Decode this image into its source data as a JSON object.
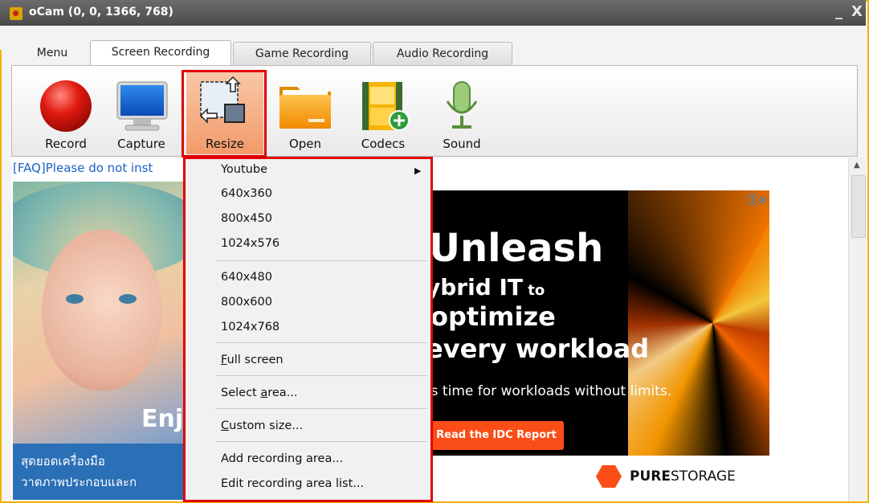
{
  "window": {
    "title": "oCam (0, 0, 1366, 768)",
    "minimize": "_",
    "close": "X"
  },
  "tabs": [
    {
      "label": "Menu"
    },
    {
      "label": "Screen Recording"
    },
    {
      "label": "Game Recording"
    },
    {
      "label": "Audio Recording"
    }
  ],
  "toolbar": {
    "record": "Record",
    "capture": "Capture",
    "resize": "Resize",
    "open": "Open",
    "codecs": "Codecs",
    "sound": "Sound"
  },
  "faq_text": "[FAQ]Please do not inst",
  "resize_menu": {
    "youtube": "Youtube",
    "r1": "640x360",
    "r2": "800x450",
    "r3": "1024x576",
    "r4": "640x480",
    "r5": "800x600",
    "r6": "1024x768",
    "full_prefix": "F",
    "full_rest": "ull screen",
    "select_prefix": "Select ",
    "select_accel": "a",
    "select_rest": "rea...",
    "custom_prefix": "C",
    "custom_rest": "ustom size...",
    "add_area": "Add recording area...",
    "edit_area": "Edit recording area list..."
  },
  "ad_left": {
    "enjoy": "Enj",
    "thai_line1": "สุดยอดเครื่องมือ",
    "thai_line2": "วาดภาพประกอบและก"
  },
  "ad_right": {
    "headline1": "Unleash",
    "headline2": "ybrid IT",
    "headline2_small": " to",
    "headline3": "optimize",
    "headline4": "every workload",
    "tagline": "'s time for workloads without limits.",
    "cta": "Read the IDC Report",
    "brand_bold": "PURE",
    "brand_rest": "STORAGE",
    "adchoices": "ⓘ✕"
  },
  "colors": {
    "accent_border": "#f2b100",
    "highlight": "#e00000",
    "link": "#1a62c5",
    "cta": "#fa4d17"
  }
}
